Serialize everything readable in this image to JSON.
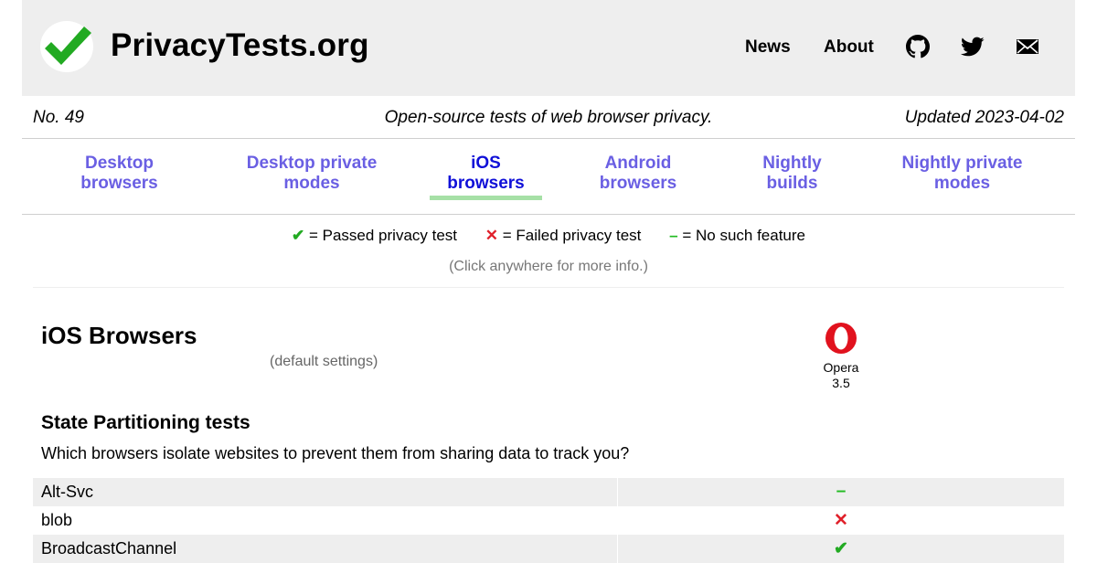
{
  "site": {
    "title": "PrivacyTests.org"
  },
  "nav": {
    "news": "News",
    "about": "About",
    "icons": [
      "github-icon",
      "twitter-icon",
      "email-icon"
    ]
  },
  "subheader": {
    "issue": "No. 49",
    "tagline": "Open-source tests of web browser privacy.",
    "updated": "Updated 2023-04-02"
  },
  "tabs": [
    {
      "label_line1": "Desktop",
      "label_line2": "browsers"
    },
    {
      "label_line1": "Desktop private",
      "label_line2": "modes"
    },
    {
      "label_line1": "iOS",
      "label_line2": "browsers",
      "active": true
    },
    {
      "label_line1": "Android",
      "label_line2": "browsers"
    },
    {
      "label_line1": "Nightly",
      "label_line2": "builds"
    },
    {
      "label_line1": "Nightly private",
      "label_line2": "modes"
    }
  ],
  "legend": {
    "pass_symbol": "✔",
    "pass_text": "= Passed privacy test",
    "fail_symbol": "✕",
    "fail_text": "= Failed privacy test",
    "none_symbol": "–",
    "none_text": "= No such feature",
    "click_info": "(Click anywhere for more info.)"
  },
  "section": {
    "title": "iOS Browsers",
    "settings": "(default settings)"
  },
  "browser": {
    "name": "Opera",
    "version": "3.5",
    "icon": "opera-icon"
  },
  "group": {
    "title": "State Partitioning tests",
    "description": "Which browsers isolate websites to prevent them from sharing data to track you?"
  },
  "rows": [
    {
      "label": "Alt-Svc",
      "result": "–"
    },
    {
      "label": "blob",
      "result": "✕"
    },
    {
      "label": "BroadcastChannel",
      "result": "✔"
    }
  ],
  "colors": {
    "pass": "#22aa22",
    "fail": "#e0202a",
    "none": "#22bb22",
    "tab": "#6a5fe3",
    "tab_active": "#1010d8"
  }
}
